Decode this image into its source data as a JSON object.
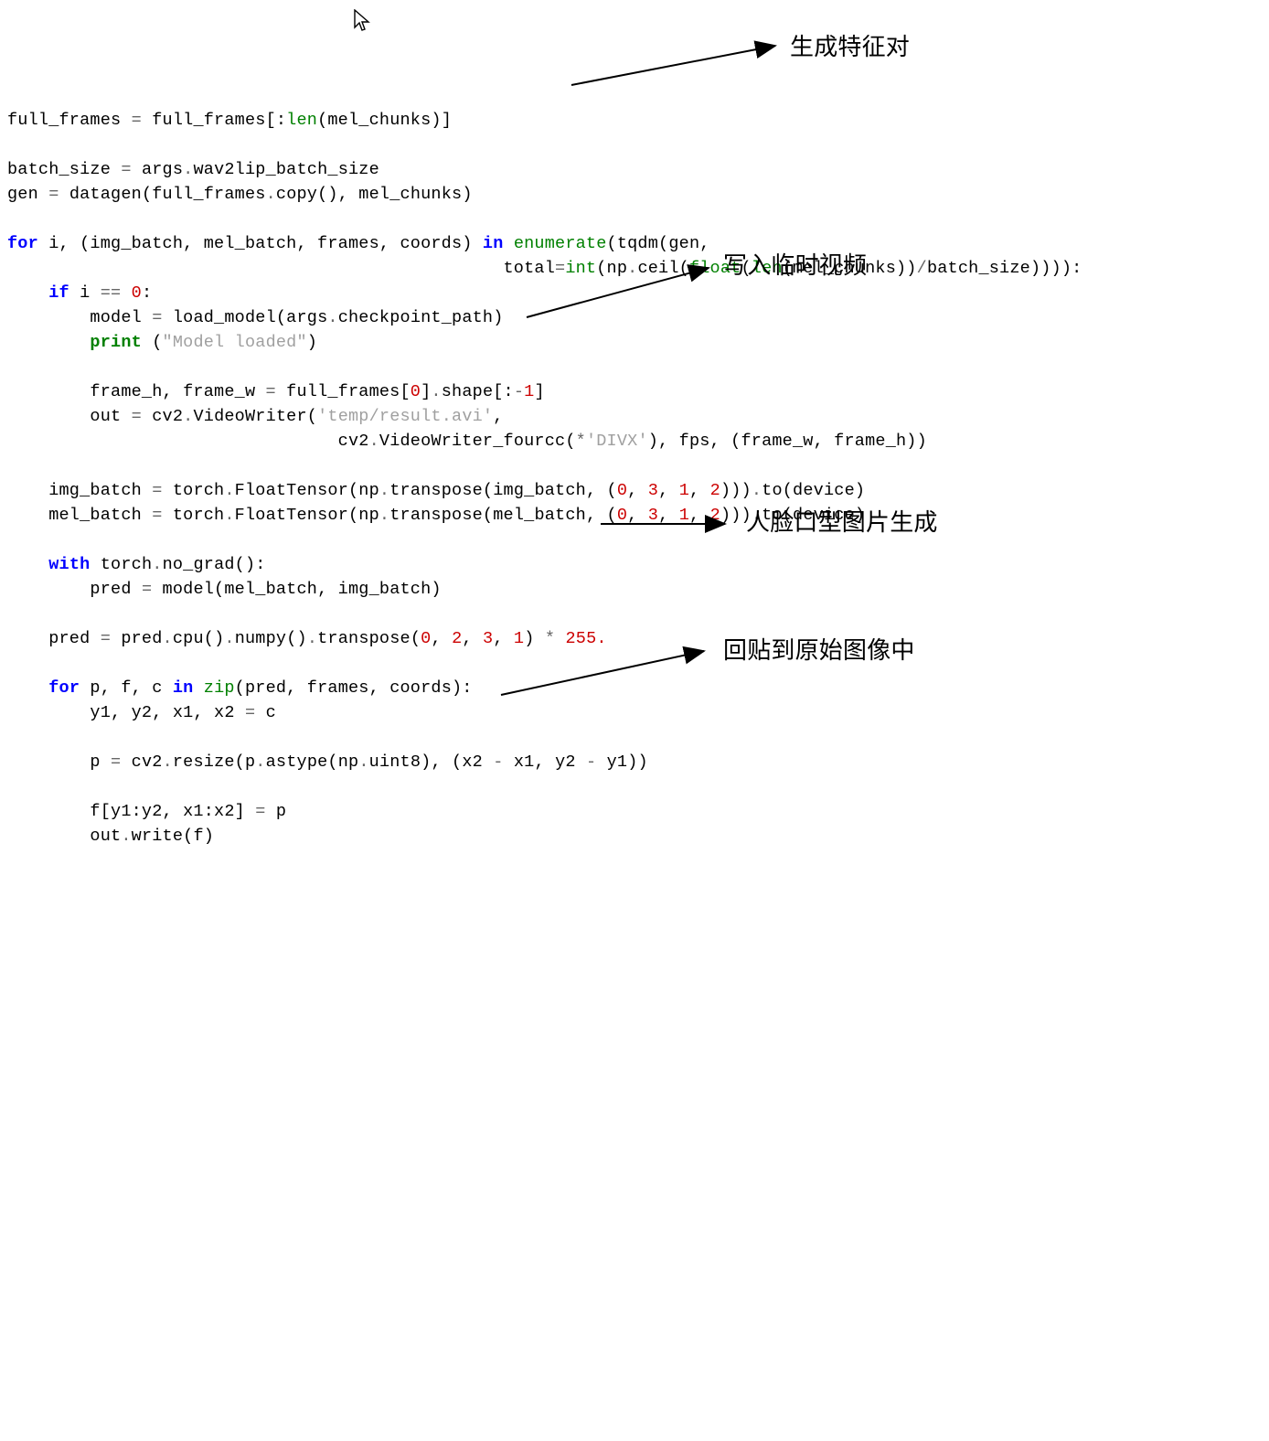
{
  "annotations": {
    "a1": "生成特征对",
    "a2": "写入临时视频",
    "a3": "人脸口型图片生成",
    "a4": "回贴到原始图像中"
  },
  "code": {
    "l01_a": "full_frames ",
    "l01_b": "=",
    "l01_c": " full_frames",
    "l01_d": "[:",
    "l01_e": "len",
    "l01_f": "(mel_chunks)",
    "l01_g": "]",
    "l03_a": "batch_size ",
    "l03_b": "=",
    "l03_c": " args",
    "l03_d": ".",
    "l03_e": "wav2lip_batch_size",
    "l04_a": "gen ",
    "l04_b": "=",
    "l04_c": " datagen(full_frames",
    "l04_d": ".",
    "l04_e": "copy(), mel_chunks)",
    "l06_a": "for",
    "l06_b": " i, (img_batch, mel_batch, frames, coords) ",
    "l06_c": "in",
    "l06_d": " ",
    "l06_e": "enumerate",
    "l06_f": "(tqdm(gen,",
    "l07_a": "                                                total",
    "l07_b": "=",
    "l07_c": "int",
    "l07_d": "(np",
    "l07_e": ".",
    "l07_f": "ceil(",
    "l07_g": "float",
    "l07_h": "(",
    "l07_i": "len",
    "l07_j": "(mel_chunks))",
    "l07_k": "/",
    "l07_l": "batch_size)))):",
    "l08_a": "    ",
    "l08_b": "if",
    "l08_c": " i ",
    "l08_d": "==",
    "l08_e": " ",
    "l08_f": "0",
    "l08_g": ":",
    "l09_a": "        model ",
    "l09_b": "=",
    "l09_c": " load_model(args",
    "l09_d": ".",
    "l09_e": "checkpoint_path)",
    "l10_a": "        ",
    "l10_b": "print",
    "l10_c": " (",
    "l10_d": "\"Model loaded\"",
    "l10_e": ")",
    "l12_a": "        frame_h, frame_w ",
    "l12_b": "=",
    "l12_c": " full_frames[",
    "l12_d": "0",
    "l12_e": "]",
    "l12_f": ".",
    "l12_g": "shape[:",
    "l12_h": "-",
    "l12_i": "1",
    "l12_j": "]",
    "l13_a": "        out ",
    "l13_b": "=",
    "l13_c": " cv2",
    "l13_d": ".",
    "l13_e": "VideoWriter(",
    "l13_f": "'temp/result.avi'",
    "l13_g": ",",
    "l14_a": "                                cv2",
    "l14_b": ".",
    "l14_c": "VideoWriter_fourcc(",
    "l14_d": "*",
    "l14_e": "'DIVX'",
    "l14_f": "), fps, (frame_w, frame_h))",
    "l16_a": "    img_batch ",
    "l16_b": "=",
    "l16_c": " torch",
    "l16_d": ".",
    "l16_e": "FloatTensor(np",
    "l16_f": ".",
    "l16_g": "transpose(img_batch, (",
    "l16_h": "0",
    "l16_i": ", ",
    "l16_j": "3",
    "l16_k": ", ",
    "l16_l": "1",
    "l16_m": ", ",
    "l16_n": "2",
    "l16_o": ")))",
    "l16_p": ".",
    "l16_q": "to(device)",
    "l17_a": "    mel_batch ",
    "l17_b": "=",
    "l17_c": " torch",
    "l17_d": ".",
    "l17_e": "FloatTensor(np",
    "l17_f": ".",
    "l17_g": "transpose(mel_batch, (",
    "l17_h": "0",
    "l17_i": ", ",
    "l17_j": "3",
    "l17_k": ", ",
    "l17_l": "1",
    "l17_m": ", ",
    "l17_n": "2",
    "l17_o": ")))",
    "l17_p": ".",
    "l17_q": "to(device)",
    "l19_a": "    ",
    "l19_b": "with",
    "l19_c": " torch",
    "l19_d": ".",
    "l19_e": "no_grad():",
    "l20_a": "        pred ",
    "l20_b": "=",
    "l20_c": " model(mel_batch, img_batch)",
    "l22_a": "    pred ",
    "l22_b": "=",
    "l22_c": " pred",
    "l22_d": ".",
    "l22_e": "cpu()",
    "l22_f": ".",
    "l22_g": "numpy()",
    "l22_h": ".",
    "l22_i": "transpose(",
    "l22_j": "0",
    "l22_k": ", ",
    "l22_l": "2",
    "l22_m": ", ",
    "l22_n": "3",
    "l22_o": ", ",
    "l22_p": "1",
    "l22_q": ") ",
    "l22_r": "*",
    "l22_s": " ",
    "l22_t": "255.",
    "l24_a": "    ",
    "l24_b": "for",
    "l24_c": " p, f, c ",
    "l24_d": "in",
    "l24_e": " ",
    "l24_f": "zip",
    "l24_g": "(pred, frames, coords):",
    "l25_a": "        y1, y2, x1, x2 ",
    "l25_b": "=",
    "l25_c": " c",
    "l27_a": "        p ",
    "l27_b": "=",
    "l27_c": " cv2",
    "l27_d": ".",
    "l27_e": "resize(p",
    "l27_f": ".",
    "l27_g": "astype(np",
    "l27_h": ".",
    "l27_i": "uint8), (x2 ",
    "l27_j": "-",
    "l27_k": " x1, y2 ",
    "l27_l": "-",
    "l27_m": " y1))",
    "l29_a": "        f[y1:y2, x1:x2] ",
    "l29_b": "=",
    "l29_c": " p",
    "l30_a": "        out",
    "l30_b": ".",
    "l30_c": "write(f)"
  }
}
